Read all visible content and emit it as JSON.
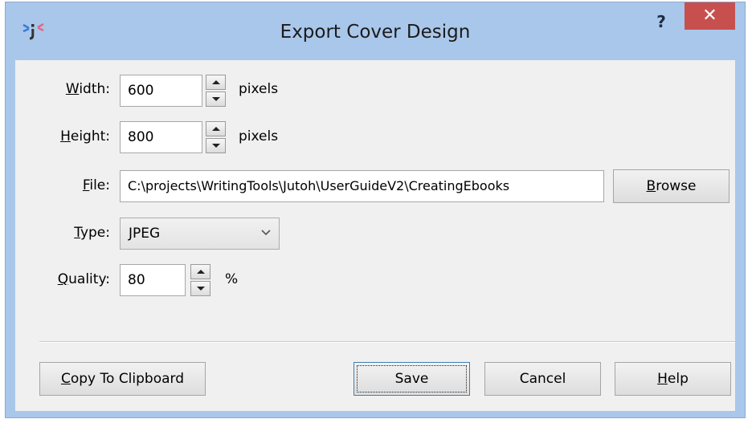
{
  "window": {
    "title": "Export Cover Design",
    "help_label": "?",
    "close_label": "✕",
    "app_icon": "jutoh-app-icon"
  },
  "form": {
    "width": {
      "label_prefix": "",
      "label_accel": "W",
      "label_rest": "idth:",
      "value": "600",
      "unit": "pixels"
    },
    "height": {
      "label_accel": "H",
      "label_rest": "eight:",
      "value": "800",
      "unit": "pixels"
    },
    "file": {
      "label_accel": "F",
      "label_rest": "ile:",
      "value": "C:\\projects\\WritingTools\\Jutoh\\UserGuideV2\\CreatingEbooks"
    },
    "type": {
      "label_accel": "T",
      "label_rest": "ype:",
      "value": "JPEG"
    },
    "quality": {
      "label_accel": "Q",
      "label_rest": "uality:",
      "value": "80",
      "unit": "%"
    }
  },
  "buttons": {
    "browse": {
      "accel": "B",
      "rest": "rowse"
    },
    "copy": {
      "accel": "C",
      "rest": "opy To Clipboard"
    },
    "save": {
      "label": "Save"
    },
    "cancel": {
      "label": "Cancel"
    },
    "help": {
      "accel": "H",
      "rest": "elp"
    }
  },
  "colors": {
    "frame": "#a9c7ea",
    "close": "#c7504f",
    "client": "#f0f0f0"
  }
}
